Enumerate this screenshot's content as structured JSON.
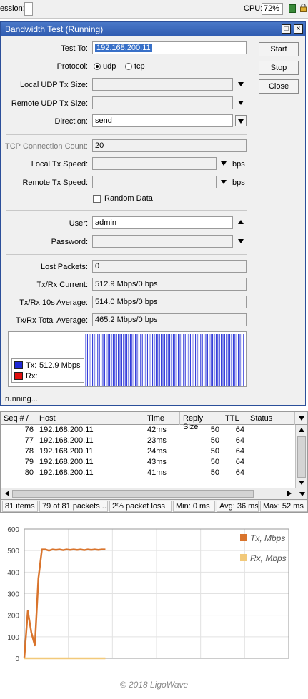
{
  "topbar": {
    "session_label": "ession:",
    "cpu_label": "CPU:",
    "cpu_value": "72%"
  },
  "window": {
    "title": "Bandwidth Test (Running)",
    "buttons": {
      "start": "Start",
      "stop": "Stop",
      "close": "Close"
    },
    "labels": {
      "test_to": "Test To:",
      "protocol": "Protocol:",
      "local_udp": "Local UDP Tx Size:",
      "remote_udp": "Remote UDP Tx Size:",
      "direction": "Direction:",
      "tcp_count": "TCP Connection Count:",
      "local_speed": "Local Tx Speed:",
      "remote_speed": "Remote Tx Speed:",
      "random_data": "Random Data",
      "user": "User:",
      "password": "Password:",
      "lost_packets": "Lost Packets:",
      "current": "Tx/Rx Current:",
      "avg10": "Tx/Rx 10s Average:",
      "total_avg": "Tx/Rx Total Average:",
      "bps1": "bps",
      "bps2": "bps"
    },
    "values": {
      "test_to": "192.168.200.11",
      "protocol_udp": "udp",
      "protocol_tcp": "tcp",
      "direction": "send",
      "tcp_count": "20",
      "user": "admin",
      "lost_packets": "0",
      "current": "512.9 Mbps/0 bps",
      "avg10": "514.0 Mbps/0 bps",
      "total_avg": "465.2 Mbps/0 bps"
    },
    "legend": {
      "tx_label": "Tx:",
      "tx_value": "512.9 Mbps",
      "rx_label": "Rx:"
    },
    "status": "running..."
  },
  "table": {
    "headers": [
      "Seq # /",
      "Host",
      "Time",
      "Reply Size",
      "TTL",
      "Status"
    ],
    "rows": [
      {
        "seq": "76",
        "host": "192.168.200.11",
        "time": "42ms",
        "size": "50",
        "ttl": "64"
      },
      {
        "seq": "77",
        "host": "192.168.200.11",
        "time": "23ms",
        "size": "50",
        "ttl": "64"
      },
      {
        "seq": "78",
        "host": "192.168.200.11",
        "time": "24ms",
        "size": "50",
        "ttl": "64"
      },
      {
        "seq": "79",
        "host": "192.168.200.11",
        "time": "43ms",
        "size": "50",
        "ttl": "64"
      },
      {
        "seq": "80",
        "host": "192.168.200.11",
        "time": "41ms",
        "size": "50",
        "ttl": "64"
      }
    ]
  },
  "summary": [
    "81 items",
    "79 of 81 packets ...",
    "2% packet loss",
    "Min: 0 ms",
    "Avg: 36 ms",
    "Max: 52 ms"
  ],
  "colors": {
    "tx_graph": "#1e28d6",
    "tx_line": "#d9742c",
    "rx_line": "#f2c97a",
    "rx_swatch": "#e01010"
  },
  "chart_data": {
    "type": "line",
    "ylim": [
      0,
      600
    ],
    "yticks": [
      0,
      100,
      200,
      300,
      400,
      500,
      600
    ],
    "series": [
      {
        "name": "Tx, Mbps",
        "x": [
          0,
          1,
          2,
          3,
          4,
          5,
          6,
          7,
          8,
          9,
          10,
          11,
          12,
          13,
          14,
          15,
          16,
          17,
          18,
          19,
          20,
          21,
          22,
          23
        ],
        "values": [
          0,
          220,
          120,
          60,
          370,
          505,
          505,
          500,
          505,
          503,
          505,
          502,
          505,
          503,
          505,
          503,
          505,
          502,
          505,
          503,
          505,
          503,
          505,
          505
        ]
      },
      {
        "name": "Rx, Mbps",
        "x": [
          0,
          23
        ],
        "values": [
          0,
          0
        ]
      }
    ],
    "x_max": 75,
    "legend": "right"
  },
  "footer": {
    "copyright": "© 2018 LigoWave"
  }
}
